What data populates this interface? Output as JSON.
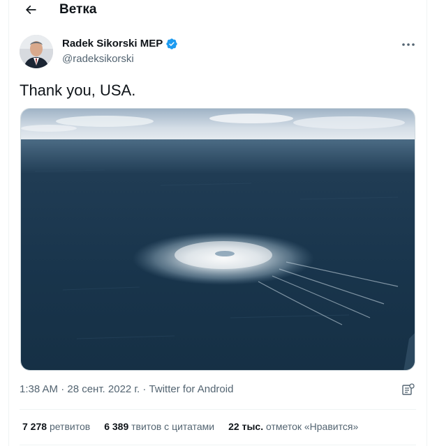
{
  "header": {
    "title": "Ветка",
    "back_icon": "arrow-left-icon"
  },
  "author": {
    "name": "Radek Sikorski MEP",
    "handle": "@radeksikorski",
    "verified": true,
    "verified_color": "#1d9bf0"
  },
  "tweet": {
    "text": "Thank you, USA.",
    "timestamp": "1:38 AM · 28 сент. 2022 г. · Twitter for Android"
  },
  "stats": {
    "retweets_count": "7 278",
    "retweets_label": "ретвитов",
    "quotes_count": "6 389",
    "quotes_label": "твитов с цитатами",
    "likes_count": "22 тыс.",
    "likes_label": "отметок «Нравится»"
  },
  "colors": {
    "text_primary": "#0f1419",
    "text_secondary": "#536471",
    "accent": "#1d9bf0",
    "border": "#eff3f4"
  }
}
